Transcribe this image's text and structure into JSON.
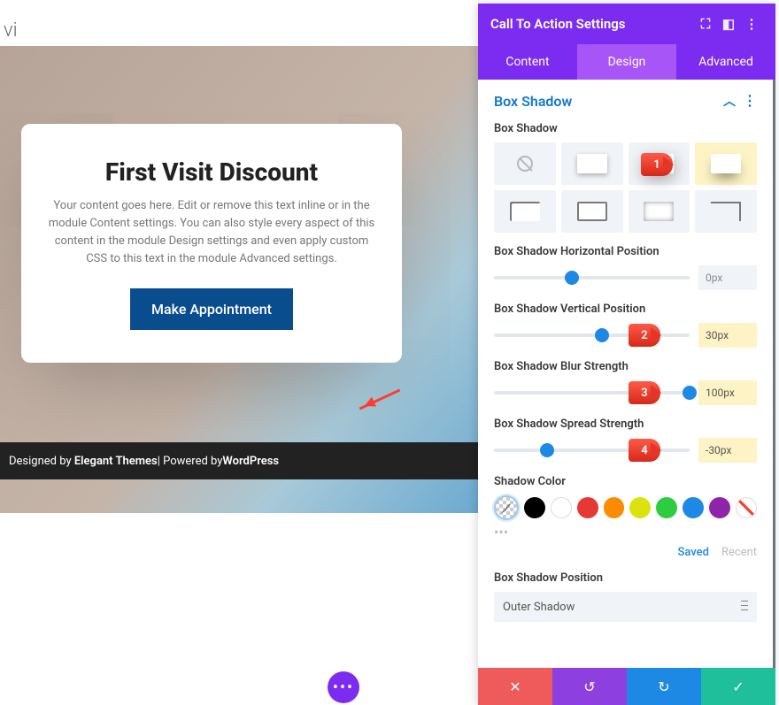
{
  "preview": {
    "logo": "vi",
    "card": {
      "title": "First Visit Discount",
      "desc": "Your content goes here. Edit or remove this text inline or in the module Content settings. You can also style every aspect of this content in the module Design settings and even apply custom CSS to this text in the module Advanced settings.",
      "button": "Make Appointment"
    },
    "footer": {
      "prefix": "Designed by ",
      "brand": "Elegant Themes",
      "mid": " | Powered by ",
      "platform": "WordPress"
    },
    "fab": "•••"
  },
  "panel": {
    "title": "Call To Action Settings",
    "tabs": {
      "content": "Content",
      "design": "Design",
      "advanced": "Advanced",
      "active": "design"
    },
    "section": "Box Shadow",
    "labels": {
      "boxshadow": "Box Shadow",
      "hpos": "Box Shadow Horizontal Position",
      "vpos": "Box Shadow Vertical Position",
      "blur": "Box Shadow Blur Strength",
      "spread": "Box Shadow Spread Strength",
      "color": "Shadow Color",
      "position": "Box Shadow Position"
    },
    "values": {
      "hpos": "0px",
      "vpos": "30px",
      "blur": "100px",
      "spread": "-30px"
    },
    "thumb_pct": {
      "hpos": 40,
      "vpos": 55,
      "blur": 100,
      "spread": 27
    },
    "color_links": {
      "saved": "Saved",
      "recent": "Recent"
    },
    "swatches": [
      "#000000",
      "#ffffff",
      "#e53935",
      "#fb8c00",
      "#dce20b",
      "#2ecc40",
      "#1e88e5",
      "#8e24aa",
      "slash"
    ],
    "position_value": "Outer Shadow",
    "annotations": {
      "1": "1",
      "2": "2",
      "3": "3",
      "4": "4"
    }
  }
}
